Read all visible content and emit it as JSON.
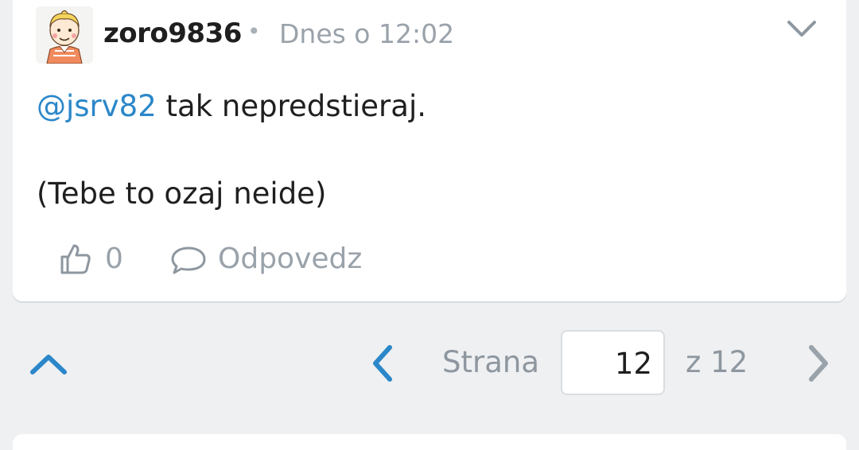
{
  "post": {
    "username": "zoro9836",
    "separator": "•",
    "timestamp": "Dnes o 12:02",
    "mention": "@jsrv82",
    "line1_rest": " tak nepredstieraj.",
    "line2": "(Tebe to ozaj neide)",
    "likes": "0",
    "reply_label": "Odpovedz"
  },
  "pagination": {
    "label": "Strana",
    "current_page": "12",
    "of_label": "z 12"
  },
  "icons": {
    "avatar": "cartoon-boy-avatar",
    "menu": "chevron-down-icon",
    "like": "thumbs-up-icon",
    "reply": "speech-bubble-icon",
    "scroll_top": "chevron-up-icon",
    "prev": "chevron-left-icon",
    "next": "chevron-right-icon"
  },
  "colors": {
    "accent": "#2b87c9",
    "muted": "#9aa2aa",
    "background": "#eef0f2"
  }
}
